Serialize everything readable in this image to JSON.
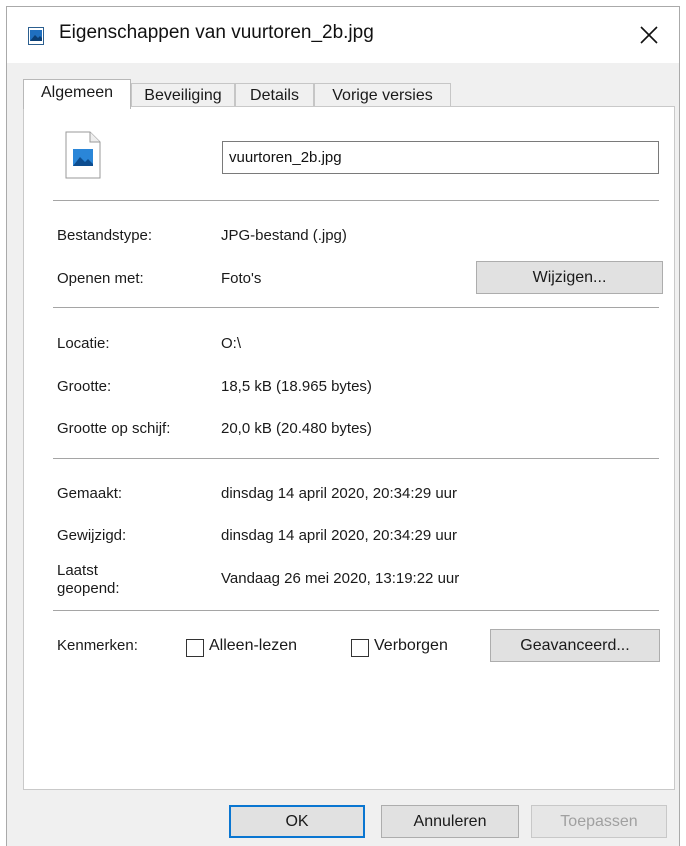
{
  "window": {
    "title": "Eigenschappen van vuurtoren_2b.jpg",
    "app_icon": "image-file-icon",
    "close_icon": "close-icon"
  },
  "tabs": [
    {
      "label": "Algemeen",
      "active": true
    },
    {
      "label": "Beveiliging",
      "active": false
    },
    {
      "label": "Details",
      "active": false
    },
    {
      "label": "Vorige versies",
      "active": false
    }
  ],
  "general": {
    "file_icon": "jpg-file-icon",
    "filename": "vuurtoren_2b.jpg",
    "type_label": "Bestandstype:",
    "type_value": "JPG-bestand (.jpg)",
    "opens_label": "Openen met:",
    "opens_value": "Foto's",
    "change_button": "Wijzigen...",
    "location_label": "Locatie:",
    "location_value": "O:\\",
    "size_label": "Grootte:",
    "size_value": "18,5 kB (18.965 bytes)",
    "disk_size_label": "Grootte op schijf:",
    "disk_size_value": "20,0 kB (20.480 bytes)",
    "created_label": "Gemaakt:",
    "created_value": "dinsdag 14 april 2020, 20:34:29 uur",
    "modified_label": "Gewijzigd:",
    "modified_value": "dinsdag 14 april 2020, 20:34:29 uur",
    "accessed_label_line1": "Laatst",
    "accessed_label_line2": "geopend:",
    "accessed_value": "Vandaag 26 mei 2020, 13:19:22 uur",
    "attributes_label": "Kenmerken:",
    "readonly_label": "Alleen-lezen",
    "readonly_checked": false,
    "hidden_label": "Verborgen",
    "hidden_checked": false,
    "advanced_button": "Geavanceerd..."
  },
  "footer": {
    "ok": "OK",
    "cancel": "Annuleren",
    "apply": "Toepassen"
  },
  "colors": {
    "accent": "#0a76d1",
    "dialog_bg": "#f0f0f0",
    "panel_bg": "#ffffff"
  }
}
